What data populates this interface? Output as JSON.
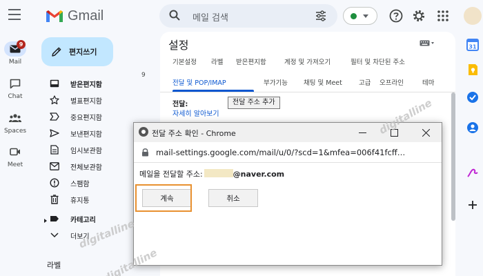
{
  "app": {
    "name": "Gmail"
  },
  "search": {
    "placeholder": "메일 검색"
  },
  "rail": {
    "mail": {
      "label": "Mail",
      "badge": "9"
    },
    "chat": {
      "label": "Chat"
    },
    "spaces": {
      "label": "Spaces"
    },
    "meet": {
      "label": "Meet"
    }
  },
  "nav": {
    "compose": "편지쓰기",
    "inbox_count": "9",
    "items": [
      {
        "label": "받은편지함",
        "icon": "inbox-icon",
        "bold": true
      },
      {
        "label": "별표편지함",
        "icon": "star-icon",
        "bold": false
      },
      {
        "label": "중요편지함",
        "icon": "important-icon",
        "bold": false
      },
      {
        "label": "보낸편지함",
        "icon": "send-icon",
        "bold": false
      },
      {
        "label": "임시보관함",
        "icon": "draft-icon",
        "bold": false
      },
      {
        "label": "전체보관함",
        "icon": "all-mail-icon",
        "bold": false
      },
      {
        "label": "스팸함",
        "icon": "spam-icon",
        "bold": false
      },
      {
        "label": "휴지통",
        "icon": "trash-icon",
        "bold": false
      },
      {
        "label": "카테고리",
        "icon": "label-icon",
        "bold": true
      },
      {
        "label": "더보기",
        "icon": "chevron-down-icon",
        "bold": false
      }
    ],
    "labels_heading": "라벨"
  },
  "settings": {
    "title": "설정",
    "tabs_row1": [
      "기본설정",
      "라벨",
      "받은편지함",
      "계정 및 가져오기",
      "필터 및 차단된 주소"
    ],
    "tabs_row2": [
      "전달 및 POP/IMAP",
      "부가기능",
      "채팅 및 Meet",
      "고급",
      "오프라인",
      "테마"
    ],
    "active_tab": "전달 및 POP/IMAP",
    "forwarding_label": "전달:",
    "learn_more": "자세히 알아보기",
    "add_forwarding_button": "전달 주소 추가"
  },
  "dialog": {
    "window_title": "전달 주소 확인 - Chrome",
    "url": "mail-settings.google.com/mail/u/0/?scd=1&mfea=006f41fcff…",
    "message_prefix": "메일을 전달할 주소:",
    "email_domain": "@naver.com",
    "continue_button": "계속",
    "cancel_button": "취소"
  },
  "watermarks": [
    "digitalline",
    "digitalline",
    "digitalline"
  ],
  "colors": {
    "accent": "#0b57d0",
    "compose_bg": "#c2e7ff",
    "highlight": "#e8902f",
    "badge": "#b3261e",
    "status_online": "#1e8e3e"
  }
}
